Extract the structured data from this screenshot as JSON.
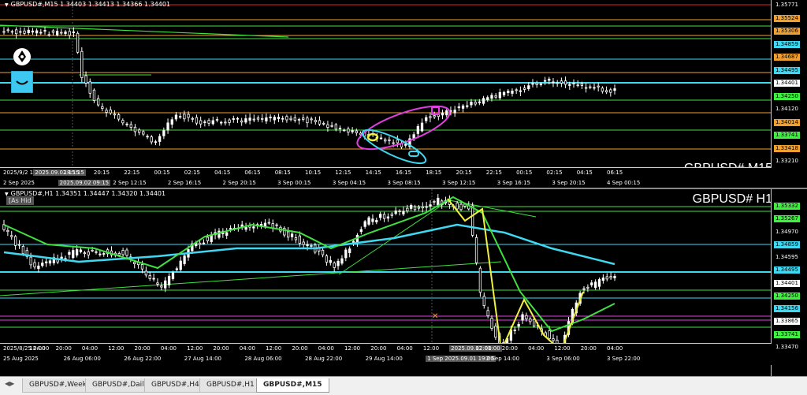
{
  "top_chart": {
    "header": "GBPUSD#,M15  1.34403 1.34413 1.34366 1.34401",
    "big_label": "GBPUSD# M15",
    "price_labels": [
      {
        "text": "1.35771",
        "color": "#ffffff",
        "bg": "#000000"
      },
      {
        "text": "1.35524",
        "color": "#000000",
        "bg": "#f0a030"
      },
      {
        "text": "1.35306",
        "color": "#000000",
        "bg": "#f0a030"
      },
      {
        "text": "1.34859",
        "color": "#000000",
        "bg": "#40d8f0"
      },
      {
        "text": "1.34687",
        "color": "#000000",
        "bg": "#f0a030"
      },
      {
        "text": "1.34495",
        "color": "#000000",
        "bg": "#40d8f0"
      },
      {
        "text": "1.34401",
        "color": "#000000",
        "bg": "#ffffff"
      },
      {
        "text": "1.34250",
        "color": "#000000",
        "bg": "#40f040"
      },
      {
        "text": "1.34120",
        "color": "#ffffff",
        "bg": "#000000"
      },
      {
        "text": "1.34014",
        "color": "#000000",
        "bg": "#f0a030"
      },
      {
        "text": "1.33741",
        "color": "#000000",
        "bg": "#40f040"
      },
      {
        "text": "1.33418",
        "color": "#000000",
        "bg": "#f0a030"
      },
      {
        "text": "1.33210",
        "color": "#ffffff",
        "bg": "#000000"
      }
    ],
    "time_labels": [
      {
        "text": "2025/9/2 12:15",
        "hl": false
      },
      {
        "text": "2025.09.02 15:15",
        "hl": true
      },
      {
        "text": "18:15",
        "hl": false
      },
      {
        "text": "20:15",
        "hl": false
      },
      {
        "text": "22:15",
        "hl": false
      },
      {
        "text": "00:15",
        "hl": false
      },
      {
        "text": "02:15",
        "hl": false
      },
      {
        "text": "04:15",
        "hl": false
      },
      {
        "text": "06:15",
        "hl": false
      },
      {
        "text": "08:15",
        "hl": false
      },
      {
        "text": "10:15",
        "hl": false
      },
      {
        "text": "12:15",
        "hl": false
      },
      {
        "text": "14:15",
        "hl": false
      },
      {
        "text": "16:15",
        "hl": false
      },
      {
        "text": "18:15",
        "hl": false
      },
      {
        "text": "20:15",
        "hl": false
      },
      {
        "text": "22:15",
        "hl": false
      },
      {
        "text": "00:15",
        "hl": false
      },
      {
        "text": "02:15",
        "hl": false
      },
      {
        "text": "04:15",
        "hl": false
      },
      {
        "text": "06:15",
        "hl": false
      }
    ],
    "time_labels_row2": [
      {
        "text": "2 Sep 2025",
        "hl": false
      },
      {
        "text": "2025.09.02 09:15",
        "hl": true
      },
      {
        "text": "2 Sep 12:15",
        "hl": false
      },
      {
        "text": "2 Sep 16:15",
        "hl": false
      },
      {
        "text": "2 Sep 20:15",
        "hl": false
      },
      {
        "text": "3 Sep 00:15",
        "hl": false
      },
      {
        "text": "3 Sep 04:15",
        "hl": false
      },
      {
        "text": "3 Sep 08:15",
        "hl": false
      },
      {
        "text": "3 Sep 12:15",
        "hl": false
      },
      {
        "text": "3 Sep 16:15",
        "hl": false
      },
      {
        "text": "3 Sep 20:15",
        "hl": false
      },
      {
        "text": "4 Sep 00:15",
        "hl": false
      }
    ]
  },
  "bottom_chart": {
    "header": "GBPUSD#,H1  1.34351 1.34447 1.34320 1.34401",
    "big_label": "GBPUSD# H1",
    "hide_button": "[As Hid",
    "price_labels": [
      {
        "text": "1.35332",
        "color": "#000000",
        "bg": "#40f040"
      },
      {
        "text": "1.35267",
        "color": "#000000",
        "bg": "#40f040"
      },
      {
        "text": "1.34970",
        "color": "#ffffff",
        "bg": "#000000"
      },
      {
        "text": "1.34859",
        "color": "#000000",
        "bg": "#40d8f0"
      },
      {
        "text": "1.34595",
        "color": "#ffffff",
        "bg": "#000000"
      },
      {
        "text": "1.34495",
        "color": "#000000",
        "bg": "#40d8f0"
      },
      {
        "text": "1.34401",
        "color": "#000000",
        "bg": "#ffffff"
      },
      {
        "text": "1.34250",
        "color": "#000000",
        "bg": "#40f040"
      },
      {
        "text": "1.34156",
        "color": "#000000",
        "bg": "#40d8f0"
      },
      {
        "text": "1.33865",
        "color": "#000000",
        "bg": "#ffffff"
      },
      {
        "text": "1.33741",
        "color": "#000000",
        "bg": "#40f040"
      },
      {
        "text": "1.33470",
        "color": "#ffffff",
        "bg": "#000000"
      }
    ],
    "time_labels": [
      {
        "text": "2025/8/25 04:00",
        "hl": false
      },
      {
        "text": "12:00",
        "hl": false
      },
      {
        "text": "20:00",
        "hl": false
      },
      {
        "text": "04:00",
        "hl": false
      },
      {
        "text": "12:00",
        "hl": false
      },
      {
        "text": "20:00",
        "hl": false
      },
      {
        "text": "04:00",
        "hl": false
      },
      {
        "text": "12:00",
        "hl": false
      },
      {
        "text": "20:00",
        "hl": false
      },
      {
        "text": "04:00",
        "hl": false
      },
      {
        "text": "12:00",
        "hl": false
      },
      {
        "text": "20:00",
        "hl": false
      },
      {
        "text": "04:00",
        "hl": false
      },
      {
        "text": "12:00",
        "hl": false
      },
      {
        "text": "20:00",
        "hl": false
      },
      {
        "text": "04:00",
        "hl": false
      },
      {
        "text": "12:00",
        "hl": false
      },
      {
        "text": "2025.09.02 01:00",
        "hl": true
      },
      {
        "text": "12:00",
        "hl": false
      },
      {
        "text": "20:00",
        "hl": false
      },
      {
        "text": "04:00",
        "hl": false
      },
      {
        "text": "12:00",
        "hl": false
      },
      {
        "text": "20:00",
        "hl": false
      },
      {
        "text": "04:00",
        "hl": false
      }
    ],
    "time_labels_row2": [
      {
        "text": "25 Aug 2025",
        "hl": false
      },
      {
        "text": "26 Aug 06:00",
        "hl": false
      },
      {
        "text": "26 Aug 22:00",
        "hl": false
      },
      {
        "text": "27 Aug 14:00",
        "hl": false
      },
      {
        "text": "28 Aug 06:00",
        "hl": false
      },
      {
        "text": "28 Aug 22:00",
        "hl": false
      },
      {
        "text": "29 Aug 14:00",
        "hl": false
      },
      {
        "text": "1 Sep 2025.09.01 19:00",
        "hl": true
      },
      {
        "text": "2 Sep 14:00",
        "hl": false
      },
      {
        "text": "3 Sep 06:00",
        "hl": false
      },
      {
        "text": "3 Sep 22:00",
        "hl": false
      }
    ]
  },
  "tabs": [
    {
      "label": "GBPUSD#,Weekly",
      "active": false
    },
    {
      "label": "GBPUSD#,Daily",
      "active": false
    },
    {
      "label": "GBPUSD#,H4",
      "active": false
    },
    {
      "label": "GBPUSD#,H1",
      "active": false
    },
    {
      "label": "GBPUSD#,M15",
      "active": true
    }
  ],
  "colors": {
    "up": "#ffffff",
    "grid": "#333333",
    "green": "#40e040",
    "cyan": "#40d8f0",
    "orange": "#f0a030",
    "magenta": "#e040e0",
    "yellow": "#f0f040"
  }
}
